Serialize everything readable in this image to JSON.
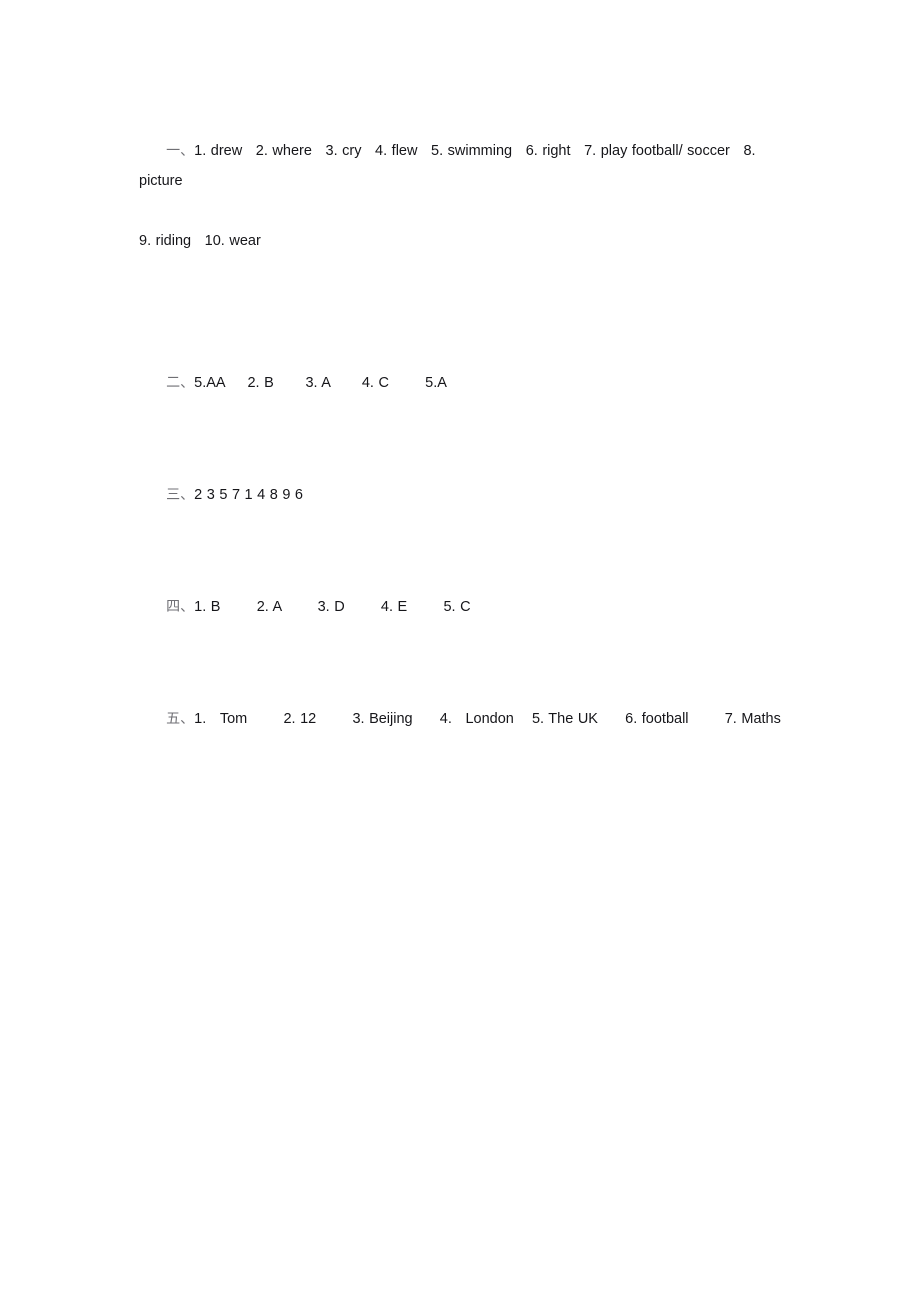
{
  "document": {
    "type": "answer-key",
    "page_background": "#ffffff",
    "text_color": "#16161a",
    "marker_color": "#6f6f74",
    "sections": [
      {
        "marker": "一、",
        "lines": [
          "1. drew   2. where   3. cry   4. flew   5. swimming   6. right   7. play football/ soccer   8. picture",
          "9. riding   10. wear"
        ],
        "answers": [
          {
            "number": "1.",
            "value": "drew"
          },
          {
            "number": "2.",
            "value": "where"
          },
          {
            "number": "3.",
            "value": "cry"
          },
          {
            "number": "4.",
            "value": "flew"
          },
          {
            "number": "5.",
            "value": "swimming"
          },
          {
            "number": "6.",
            "value": "right"
          },
          {
            "number": "7.",
            "value": "play football/ soccer"
          },
          {
            "number": "8.",
            "value": "picture"
          },
          {
            "number": "9.",
            "value": "riding"
          },
          {
            "number": "10.",
            "value": "wear"
          }
        ]
      },
      {
        "marker": "二、",
        "lines": [
          "5.AA     2. B       3. A       4. C        5.A"
        ],
        "answers": [
          {
            "number": "5.",
            "value": "AA"
          },
          {
            "number": "2.",
            "value": "B"
          },
          {
            "number": "3.",
            "value": "A"
          },
          {
            "number": "4.",
            "value": "C"
          },
          {
            "number": "5.",
            "value": "A"
          }
        ]
      },
      {
        "marker": "三、",
        "lines": [
          "2 3 5 7 1 4 8 9 6"
        ],
        "answers": [
          {
            "number": "",
            "value": "2"
          },
          {
            "number": "",
            "value": "3"
          },
          {
            "number": "",
            "value": "5"
          },
          {
            "number": "",
            "value": "7"
          },
          {
            "number": "",
            "value": "1"
          },
          {
            "number": "",
            "value": "4"
          },
          {
            "number": "",
            "value": "8"
          },
          {
            "number": "",
            "value": "9"
          },
          {
            "number": "",
            "value": "6"
          }
        ]
      },
      {
        "marker": "四、",
        "lines": [
          "1. B        2. A        3. D        4. E        5. C"
        ],
        "answers": [
          {
            "number": "1.",
            "value": "B"
          },
          {
            "number": "2.",
            "value": "A"
          },
          {
            "number": "3.",
            "value": "D"
          },
          {
            "number": "4.",
            "value": "E"
          },
          {
            "number": "5.",
            "value": "C"
          }
        ]
      },
      {
        "marker": "五、",
        "lines": [
          "1.   Tom        2. 12        3. Beijing      4.   London    5. The UK      6. football        7. Maths"
        ],
        "answers": [
          {
            "number": "1.",
            "value": "Tom"
          },
          {
            "number": "2.",
            "value": "12"
          },
          {
            "number": "3.",
            "value": "Beijing"
          },
          {
            "number": "4.",
            "value": "London"
          },
          {
            "number": "5.",
            "value": "The UK"
          },
          {
            "number": "6.",
            "value": "football"
          },
          {
            "number": "7.",
            "value": "Maths"
          }
        ]
      }
    ]
  }
}
